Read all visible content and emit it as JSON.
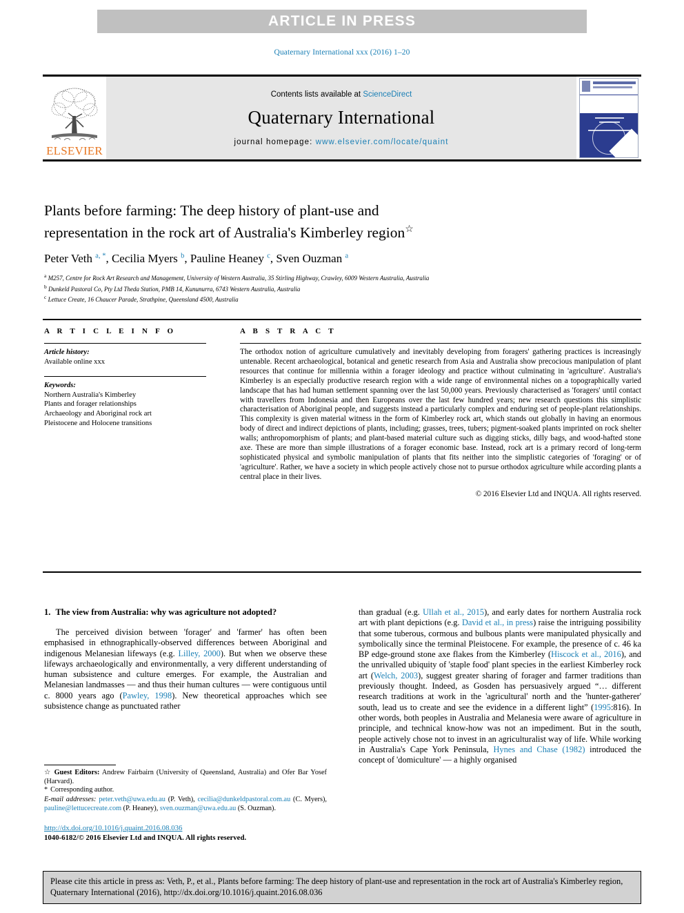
{
  "banner": {
    "label": "ARTICLE IN PRESS"
  },
  "running_head": "Quaternary International xxx (2016) 1–20",
  "masthead": {
    "publisher": "ELSEVIER",
    "contents_prefix": "Contents lists available at ",
    "contents_link": "ScienceDirect",
    "journal_title": "Quaternary International",
    "homepage_label": "journal homepage: ",
    "homepage_url": "www.elsevier.com/locate/quaint"
  },
  "title": {
    "line1": "Plants before farming: The deep history of plant-use and",
    "line2": "representation in the rock art of Australia's Kimberley region",
    "star": "☆"
  },
  "authors": [
    {
      "name": "Peter Veth",
      "marks": "a, *"
    },
    {
      "name": "Cecilia Myers",
      "marks": "b"
    },
    {
      "name": "Pauline Heaney",
      "marks": "c"
    },
    {
      "name": "Sven Ouzman",
      "marks": "a"
    }
  ],
  "affiliations": [
    {
      "mark": "a",
      "text": "M257, Centre for Rock Art Research and Management, University of Western Australia, 35 Stirling Highway, Crawley, 6009 Western Australia, Australia"
    },
    {
      "mark": "b",
      "text": "Dunkeld Pastoral Co, Pty Ltd Theda Station, PMB 14, Kununurra, 6743 Western Australia, Australia"
    },
    {
      "mark": "c",
      "text": "Lettuce Create, 16 Chaucer Parade, Strathpine, Queensland 4500, Australia"
    }
  ],
  "article_info": {
    "heading": "A R T I C L E  I N F O",
    "history_label": "Article history:",
    "history_value": "Available online xxx",
    "keywords_label": "Keywords:",
    "keywords": [
      "Northern Australia's Kimberley",
      "Plants and forager relationships",
      "Archaeology and Aboriginal rock art",
      "Pleistocene and Holocene transitions"
    ]
  },
  "abstract": {
    "heading": "A B S T R A C T",
    "text": "The orthodox notion of agriculture cumulatively and inevitably developing from foragers' gathering practices is increasingly untenable. Recent archaeological, botanical and genetic research from Asia and Australia show precocious manipulation of plant resources that continue for millennia within a forager ideology and practice without culminating in 'agriculture'. Australia's Kimberley is an especially productive research region with a wide range of environmental niches on a topographically varied landscape that has had human settlement spanning over the last 50,000 years. Previously characterised as 'foragers' until contact with travellers from Indonesia and then Europeans over the last few hundred years; new research questions this simplistic characterisation of Aboriginal people, and suggests instead a particularly complex and enduring set of people-plant relationships. This complexity is given material witness in the form of Kimberley rock art, which stands out globally in having an enormous body of direct and indirect depictions of plants, including; grasses, trees, tubers; pigment-soaked plants imprinted on rock shelter walls; anthropomorphism of plants; and plant-based material culture such as digging sticks, dilly bags, and wood-hafted stone axe. These are more than simple illustrations of a forager economic base. Instead, rock art is a primary record of long-term sophisticated physical and symbolic manipulation of plants that fits neither into the simplistic categories of 'foraging' or of 'agriculture'. Rather, we have a society in which people actively chose not to pursue orthodox agriculture while according plants a central place in their lives.",
    "copyright": "© 2016 Elsevier Ltd and INQUA. All rights reserved."
  },
  "body": {
    "section_number": "1.",
    "section_title": "The view from Australia: why was agriculture not adopted?",
    "left_paragraph_parts": [
      {
        "t": "The perceived division between 'forager' and 'farmer' has often been emphasised in ethnographically-observed differences between Aboriginal and indigenous Melanesian lifeways (e.g. ",
        "ref": false
      },
      {
        "t": "Lilley, 2000",
        "ref": true
      },
      {
        "t": "). But when we observe these lifeways archaeologically and environmentally, a very different understanding of human subsistence and culture emerges. For example, the Australian and Melanesian landmasses — and thus their human cultures — were contiguous until c. 8000 years ago (",
        "ref": false
      },
      {
        "t": "Pawley, 1998",
        "ref": true
      },
      {
        "t": "). New theoretical approaches which see subsistence change as punctuated rather",
        "ref": false
      }
    ],
    "right_paragraph_parts": [
      {
        "t": "than gradual (e.g. ",
        "ref": false
      },
      {
        "t": "Ullah et al., 2015",
        "ref": true
      },
      {
        "t": "), and early dates for northern Australia rock art with plant depictions (e.g. ",
        "ref": false
      },
      {
        "t": "David et al., in press",
        "ref": true
      },
      {
        "t": ") raise the intriguing possibility that some tuberous, cormous and bulbous plants were manipulated physically and symbolically since the terminal Pleistocene. For example, the presence of c. 46 ka BP edge-ground stone axe flakes from the Kimberley (",
        "ref": false
      },
      {
        "t": "Hiscock et al., 2016",
        "ref": true
      },
      {
        "t": "), and the unrivalled ubiquity of 'staple food' plant species in the earliest Kimberley rock art (",
        "ref": false
      },
      {
        "t": "Welch, 2003",
        "ref": true
      },
      {
        "t": "), suggest greater sharing of forager and farmer traditions than previously thought. Indeed, as Gosden has persuasively argued “… different research traditions at work in the 'agricultural' north and the 'hunter-gatherer' south, lead us to create and see the evidence in a different light” (",
        "ref": false
      },
      {
        "t": "1995",
        "ref": true
      },
      {
        "t": ":816). In other words, both peoples in Australia and Melanesia were aware of agriculture in principle, and technical know-how was not an impediment. But in the south, people actively chose not to invest in an agriculturalist way of life. While working in Australia's Cape York Peninsula, ",
        "ref": false
      },
      {
        "t": "Hynes and Chase (1982)",
        "ref": true
      },
      {
        "t": " introduced the concept of 'domiculture' — a highly organised",
        "ref": false
      }
    ]
  },
  "footnotes": {
    "guest_editors_mark": "☆",
    "guest_editors_label": "Guest Editors:",
    "guest_editors_text": " Andrew Fairbairn (University of Queensland, Australia) and Ofer Bar Yosef (Harvard).",
    "corresponding_mark": "*",
    "corresponding_text": "Corresponding author.",
    "email_label": "E-mail addresses:",
    "emails": [
      {
        "address": "peter.veth@uwa.edu.au",
        "who": " (P. Veth), "
      },
      {
        "address": "cecilia@dunkeldpastoral.com.au",
        "who": " (C. Myers), "
      },
      {
        "address": "pauline@lettucecreate.com",
        "who": " (P. Heaney), "
      },
      {
        "address": "sven.ouzman@uwa.edu.au",
        "who": " (S. Ouzman)."
      }
    ]
  },
  "doi": {
    "url": "http://dx.doi.org/10.1016/j.quaint.2016.08.036",
    "issn_line": "1040-6182/© 2016 Elsevier Ltd and INQUA. All rights reserved."
  },
  "citation_footer": {
    "text": "Please cite this article in press as: Veth, P., et al., Plants before farming: The deep history of plant-use and representation in the rock art of Australia's Kimberley region, Quaternary International (2016), http://dx.doi.org/10.1016/j.quaint.2016.08.036"
  },
  "colors": {
    "link": "#1a7fb5",
    "banner_bg": "#c0c0c0",
    "masthead_bg": "#e6e6e6",
    "elsevier_orange": "#e87722",
    "cite_box_bg": "#d2d2d2",
    "cover_blue": "#2b3c8f"
  }
}
